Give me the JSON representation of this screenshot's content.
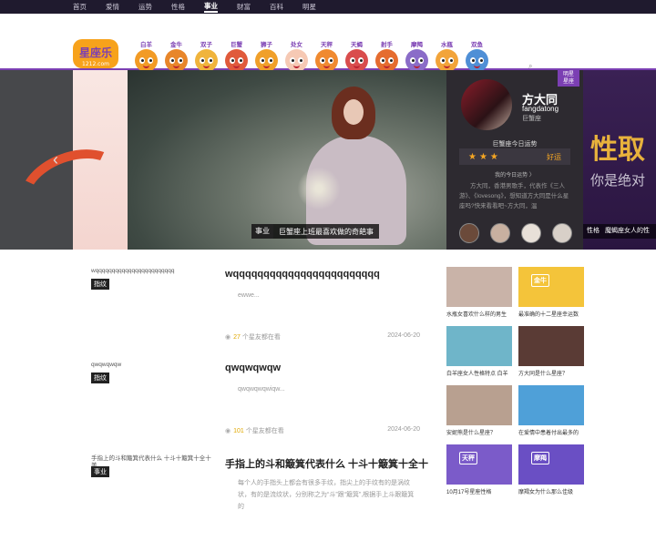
{
  "nav": [
    "首页",
    "爱情",
    "运势",
    "性格",
    "事业",
    "财富",
    "百科",
    "明星"
  ],
  "nav_active": 4,
  "logo": {
    "text": "星座乐",
    "sub": "1212.com",
    "color": "#f7a21b"
  },
  "zodiacs": [
    {
      "name": "白羊",
      "color": "#f29b25"
    },
    {
      "name": "金牛",
      "color": "#e8862a"
    },
    {
      "name": "双子",
      "color": "#f0b43c"
    },
    {
      "name": "巨蟹",
      "color": "#e05a3b"
    },
    {
      "name": "狮子",
      "color": "#f0a02a"
    },
    {
      "name": "处女",
      "color": "#f6c9b4"
    },
    {
      "name": "天秤",
      "color": "#f08a30"
    },
    {
      "name": "天蝎",
      "color": "#d94d4d"
    },
    {
      "name": "射手",
      "color": "#e56c2f"
    },
    {
      "name": "摩羯",
      "color": "#8a6cc8"
    },
    {
      "name": "水瓶",
      "color": "#f2a43a"
    },
    {
      "name": "双鱼",
      "color": "#4f8fd6"
    }
  ],
  "search": {
    "placeholder": ""
  },
  "banner": {
    "caption_tag": "事业",
    "caption_text": "巨蟹座上班最喜欢做的奇葩事",
    "right_big": "性取",
    "right_sub": "你是绝对",
    "right_caption_tag": "性格",
    "right_caption_text": "魔蝎座女人的性"
  },
  "star": {
    "badge": "明星\n星座",
    "name": "方大同",
    "pinyin": "fangdatong",
    "sign": "巨蟹座",
    "fortune_title": "巨蟹座今日运势",
    "stars": "★★★",
    "fortune_level": "好运",
    "today_label": "我的今日运势 〉",
    "bio": "方大同，香港男歌手，代表作《三人游》、《lovesong》，想知道方大同是什么星座吗?快来看看吧~方大同，温"
  },
  "articles": [
    {
      "img_alt": "wqqqqqqqqqqqqqqqqqqqqqqqq",
      "category": "指纹",
      "title": "wqqqqqqqqqqqqqqqqqqqqqqqq",
      "desc": "ewwe...",
      "likes": "27",
      "likes_suffix": "个星友都在看",
      "date": "2024-06-20"
    },
    {
      "img_alt": "qwqwqwqw",
      "category": "指纹",
      "title": "qwqwqwqw",
      "desc": "qwqwqwqwiqw...",
      "likes": "101",
      "likes_suffix": "个星友都在看",
      "date": "2024-06-20"
    },
    {
      "img_alt": "手指上的斗和簸箕代表什么 十斗十簸箕十全十美",
      "category": "事业",
      "title": "手指上的斗和簸箕代表什么 十斗十簸箕十全十",
      "desc": "每个人的手指头上都会有很多手纹，指尖上的手纹有的是涡纹状，有的是流纹状，分别称之为“斗”跟“簸箕”,根据手上斗跟簸箕的",
      "likes": "",
      "likes_suffix": "",
      "date": ""
    }
  ],
  "grid": [
    {
      "caption": "水瓶女喜欢什么样的男生",
      "bg": "#c9b3a8"
    },
    {
      "caption": "最准确的十二星座幸运数",
      "bg": "#f4c43a",
      "badge": "金牛"
    },
    {
      "caption": "白羊座女人性格特点 白羊",
      "bg": "#6fb5c9"
    },
    {
      "caption": "方大同是什么星座？",
      "bg": "#5a3b35"
    },
    {
      "caption": "安妮熊是什么星座？",
      "bg": "#b8a090"
    },
    {
      "caption": "在爱情中患着付出最多的",
      "bg": "#4fa0d8"
    },
    {
      "caption": "10月17号星座性格",
      "bg": "#7b5bc9",
      "badge": "天秤"
    },
    {
      "caption": "摩羯女为什么那么佳级",
      "bg": "#6a4fc4",
      "badge": "摩羯"
    }
  ]
}
